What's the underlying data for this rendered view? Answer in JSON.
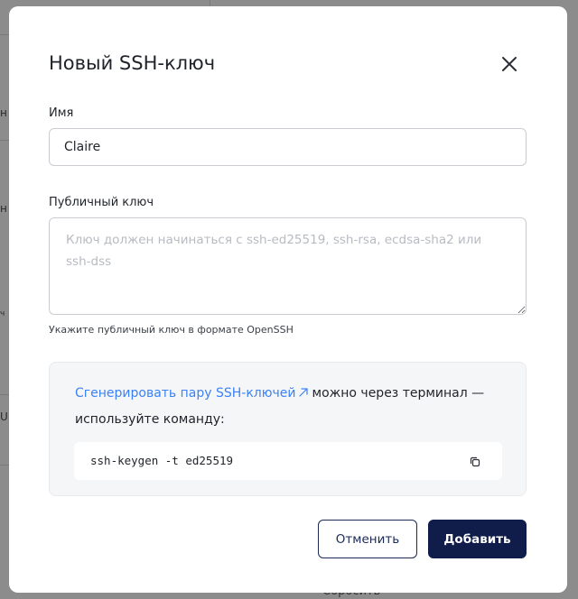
{
  "backdrop": {
    "fragments": [
      "н",
      "н",
      "ч",
      "U"
    ],
    "reset_label": "Сбросить"
  },
  "modal": {
    "title": "Новый SSH-ключ",
    "close_icon": "close-icon",
    "name_field": {
      "label": "Имя",
      "value": "Claire"
    },
    "key_field": {
      "label": "Публичный ключ",
      "placeholder": "Ключ должен начинаться с ssh-ed25519, ssh-rsa, ecdsa-sha2 или ssh-dss",
      "value": "",
      "hint": "Укажите публичный ключ в формате OpenSSH"
    },
    "info": {
      "link_text": "Сгенерировать пару SSH-ключей",
      "link_icon": "external-link-icon",
      "text": "можно через терминал — используйте команду:",
      "command": "ssh-keygen -t ed25519",
      "copy_icon": "copy-icon"
    },
    "actions": {
      "cancel_label": "Отменить",
      "add_label": "Добавить"
    }
  },
  "colors": {
    "link": "#3b82f6",
    "primary": "#101d4a",
    "backdrop": "#8c8c8c"
  }
}
